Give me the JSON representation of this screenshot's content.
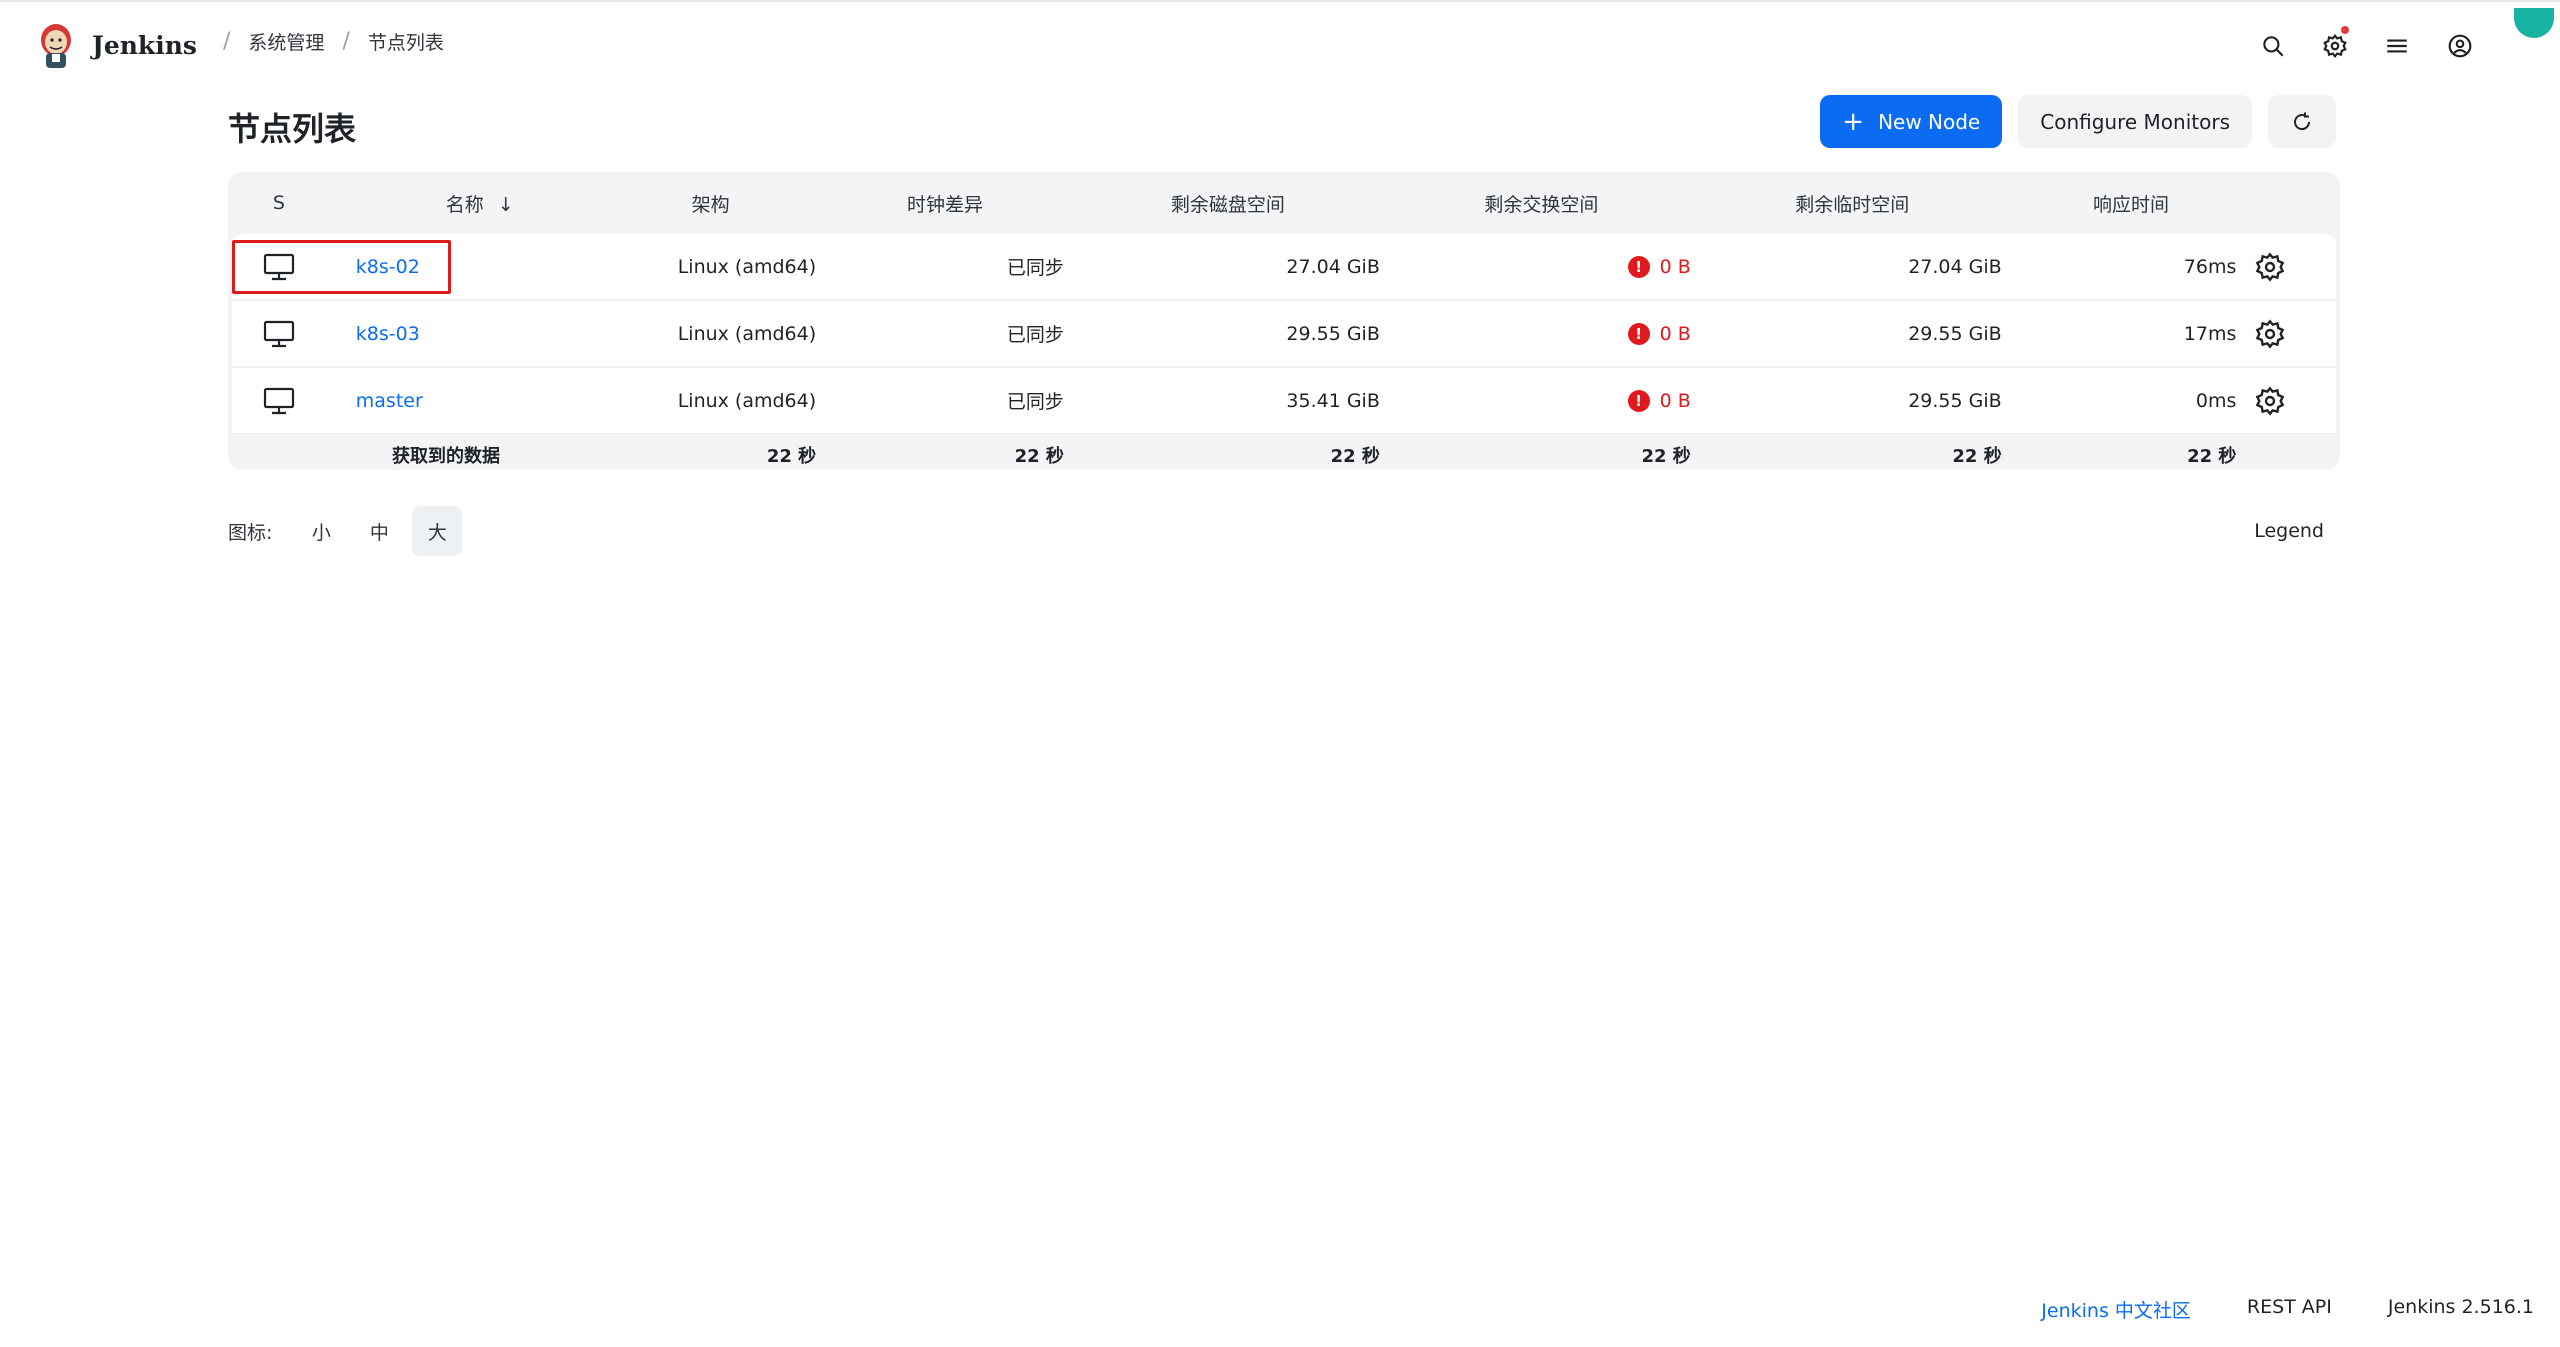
{
  "app": {
    "name": "Jenkins"
  },
  "breadcrumbs": [
    {
      "label": "系统管理"
    },
    {
      "label": "节点列表"
    }
  ],
  "page": {
    "title": "节点列表"
  },
  "actions": {
    "new_node": "New Node",
    "configure_monitors": "Configure Monitors",
    "refresh_icon": "refresh-icon"
  },
  "table": {
    "headers": {
      "s": "S",
      "name": "名称",
      "sort_indicator": "↓",
      "arch": "架构",
      "clock": "时钟差异",
      "disk": "剩余磁盘空间",
      "swap": "剩余交换空间",
      "tmp": "剩余临时空间",
      "resp": "响应时间"
    },
    "rows": [
      {
        "name": "k8s-02",
        "arch": "Linux (amd64)",
        "clock": "已同步",
        "disk": "27.04 GiB",
        "swap": "0 B",
        "tmp": "27.04 GiB",
        "resp": "76ms",
        "selected": true
      },
      {
        "name": "k8s-03",
        "arch": "Linux (amd64)",
        "clock": "已同步",
        "disk": "29.55 GiB",
        "swap": "0 B",
        "tmp": "29.55 GiB",
        "resp": "17ms"
      },
      {
        "name": "master",
        "arch": "Linux (amd64)",
        "clock": "已同步",
        "disk": "35.41 GiB",
        "swap": "0 B",
        "tmp": "29.55 GiB",
        "resp": "0ms"
      }
    ],
    "footer": {
      "label": "获取到的数据",
      "arch": "22 秒",
      "clock": "22 秒",
      "disk": "22 秒",
      "swap": "22 秒",
      "tmp": "22 秒",
      "resp": "22 秒"
    }
  },
  "icon_size": {
    "label": "图标:",
    "small": "小",
    "medium": "中",
    "large": "大",
    "selected": "大"
  },
  "legend": "Legend",
  "footer_links": {
    "community": "Jenkins 中文社区",
    "rest_api": "REST API",
    "version": "Jenkins 2.516.1"
  },
  "colors": {
    "accent": "#0b6cf3",
    "error": "#e0191c",
    "table_bg": "#f2f4f6"
  }
}
